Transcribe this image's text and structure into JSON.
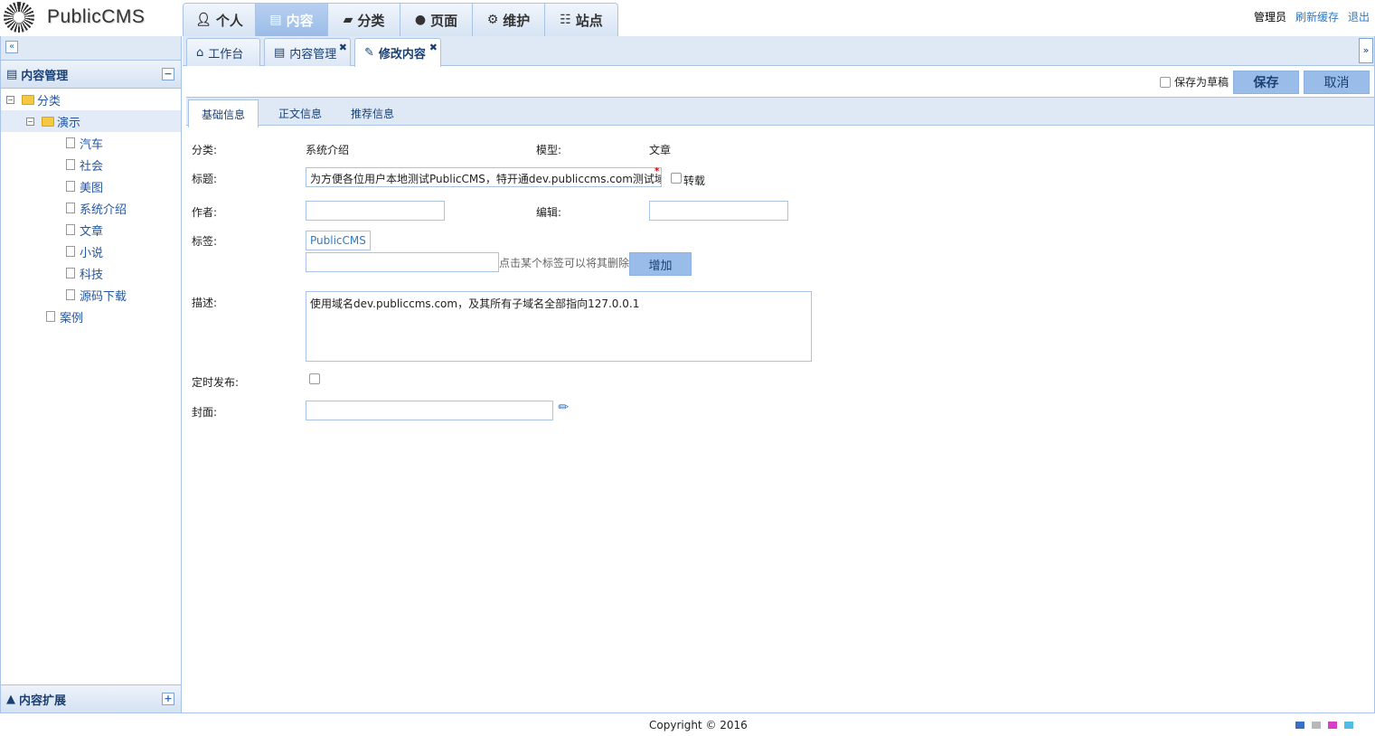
{
  "header": {
    "logo_text": "PublicCMS",
    "nav": [
      {
        "label": "个人",
        "icon": "user-icon"
      },
      {
        "label": "内容",
        "icon": "book-icon",
        "active": true
      },
      {
        "label": "分类",
        "icon": "folder-open-icon"
      },
      {
        "label": "页面",
        "icon": "globe-icon"
      },
      {
        "label": "维护",
        "icon": "gear-icon"
      },
      {
        "label": "站点",
        "icon": "sitemap-icon"
      }
    ],
    "user": "管理员",
    "refresh_cache": "刷新缓存",
    "logout": "退出"
  },
  "sidebar": {
    "panel_title": "内容管理",
    "footer_title": "内容扩展",
    "tree": [
      {
        "label": "分类",
        "level": 0,
        "type": "folder"
      },
      {
        "label": "演示",
        "level": 1,
        "type": "folder",
        "selected": true
      },
      {
        "label": "汽车",
        "level": 2,
        "type": "doc"
      },
      {
        "label": "社会",
        "level": 2,
        "type": "doc"
      },
      {
        "label": "美图",
        "level": 2,
        "type": "doc"
      },
      {
        "label": "系统介绍",
        "level": 2,
        "type": "doc"
      },
      {
        "label": "文章",
        "level": 2,
        "type": "doc"
      },
      {
        "label": "小说",
        "level": 2,
        "type": "doc"
      },
      {
        "label": "科技",
        "level": 2,
        "type": "doc"
      },
      {
        "label": "源码下载",
        "level": 2,
        "type": "doc"
      },
      {
        "label": "案例",
        "level": 1,
        "type": "doc"
      }
    ]
  },
  "page_tabs": [
    {
      "label": "工作台",
      "icon": "home-icon"
    },
    {
      "label": "内容管理",
      "icon": "book-icon"
    },
    {
      "label": "修改内容",
      "icon": "edit-icon",
      "active": true
    }
  ],
  "toolbar": {
    "save_draft": "保存为草稿",
    "save": "保存",
    "cancel": "取消"
  },
  "sub_tabs": [
    "基础信息",
    "正文信息",
    "推荐信息"
  ],
  "form": {
    "category_label": "分类:",
    "category_value": "系统介绍",
    "model_label": "模型:",
    "model_value": "文章",
    "title_label": "标题:",
    "title_value": "为方便各位用户本地测试PublicCMS，特开通dev.publiccms.com测试域名",
    "reprint_label": "转载",
    "author_label": "作者:",
    "editor_label": "编辑:",
    "tags_label": "标签:",
    "tag_chip": "PublicCMS",
    "tag_hint": "点击某个标签可以将其删除",
    "add_button": "增加",
    "desc_label": "描述:",
    "desc_value": "使用域名dev.publiccms.com，及其所有子域名全部指向127.0.0.1",
    "schedule_label": "定时发布:",
    "cover_label": "封面:"
  },
  "footer": {
    "copyright": "Copyright © 2016",
    "theme_colors": [
      "#3a6fc2",
      "#b8b8b8",
      "#d63ec9",
      "#4fbde8"
    ]
  }
}
